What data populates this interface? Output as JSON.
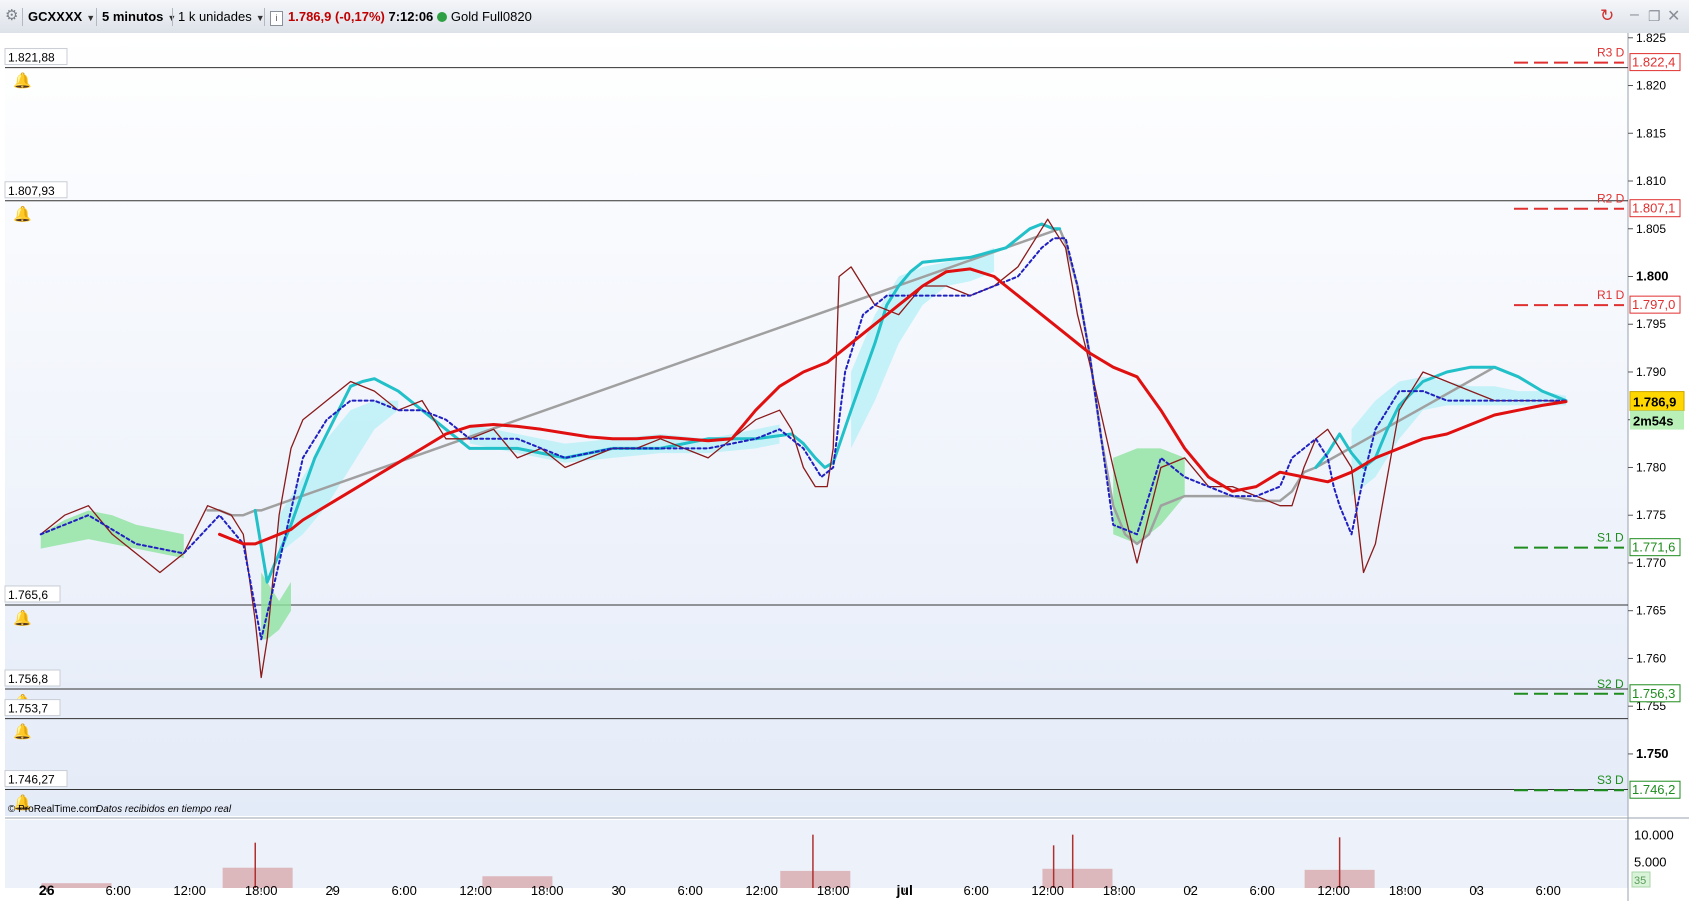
{
  "toolbar": {
    "symbol": "GCXXXX",
    "interval": "5 minutos",
    "units": "1 k unidades",
    "info_icon": "info-icon",
    "price_change": "1.786,9 (-0,17%)",
    "time": "7:12:06",
    "instrument": "Gold Full0820",
    "status_color": "#2ea043",
    "window_icons": [
      "minimize-icon",
      "restore-icon",
      "close-icon"
    ]
  },
  "chart_data": {
    "type": "line",
    "title": "",
    "credit": "© ProRealTime.com",
    "credit_note": "Datos recibidos en tiempo real",
    "price_axis": {
      "ylim": [
        1743.5,
        1825.5
      ],
      "ticks": [
        "1.825",
        "1.820",
        "1.815",
        "1.810",
        "1.805",
        "1.800",
        "1.795",
        "1.790",
        "1.785",
        "1.780",
        "1.775",
        "1.770",
        "1.765",
        "1.760",
        "1.755",
        "1.750"
      ],
      "bold_ticks": [
        "1.800",
        "1.750"
      ],
      "current_price": "1.786,9",
      "countdown": "2m54s"
    },
    "x_axis": {
      "labels": [
        "26",
        "6:00",
        "12:00",
        "18:00",
        "29",
        "6:00",
        "12:00",
        "18:00",
        "30",
        "6:00",
        "12:00",
        "18:00",
        "jul",
        "6:00",
        "12:00",
        "18:00",
        "02",
        "6:00",
        "12:00",
        "18:00",
        "03",
        "6:00"
      ],
      "bold_labels": [
        "26",
        "29",
        "30",
        "jul",
        "02",
        "03"
      ],
      "label_positions": [
        0.5,
        6.5,
        12.5,
        18.5,
        24.5,
        30.5,
        36.5,
        42.5,
        48.5,
        54.5,
        60.5,
        66.5,
        72.5,
        78.5,
        84.5,
        90.5,
        96.5,
        102.5,
        108.5,
        114.5,
        120.5,
        126.5
      ],
      "xlim": [
        -3.0,
        133.2
      ]
    },
    "alert_lines": [
      {
        "label": "1.821,88",
        "value": 1821.88
      },
      {
        "label": "1.807,93",
        "value": 1807.93
      },
      {
        "label": "1.765,6",
        "value": 1765.6
      },
      {
        "label": "1.756,8",
        "value": 1756.8
      },
      {
        "label": "1.753,7",
        "value": 1753.7
      },
      {
        "label": "1.746,27",
        "value": 1746.27
      }
    ],
    "pivot_levels": [
      {
        "name": "R3 D",
        "value_label": "1.822,4",
        "value": 1822.4,
        "color": "#e03030"
      },
      {
        "name": "R2 D",
        "value_label": "1.807,1",
        "value": 1807.1,
        "color": "#e03030"
      },
      {
        "name": "R1 D",
        "value_label": "1.797,0",
        "value": 1797.0,
        "color": "#e03030"
      },
      {
        "name": "S1 D",
        "value_label": "1.771,6",
        "value": 1771.6,
        "color": "#1e8c1e"
      },
      {
        "name": "S2 D",
        "value_label": "1.756,3",
        "value": 1756.3,
        "color": "#1e8c1e"
      },
      {
        "name": "S3 D",
        "value_label": "1.746,2",
        "value": 1746.2,
        "color": "#1e8c1e"
      }
    ],
    "series": [
      {
        "key": "price",
        "color": "#8b1a1a",
        "x": [
          0,
          2,
          4,
          6,
          8,
          10,
          12,
          14,
          16,
          17,
          18,
          18.5,
          19,
          20,
          21,
          22,
          23,
          24,
          26,
          28,
          30,
          32,
          34,
          36,
          38,
          40,
          42,
          44,
          46,
          48,
          50,
          52,
          54,
          56,
          58,
          60,
          62,
          63,
          64,
          65,
          66,
          66.5,
          67,
          68,
          70,
          72,
          74,
          76,
          78,
          80,
          82,
          83,
          84,
          84.5,
          85,
          86,
          87,
          88,
          90,
          92,
          94,
          96,
          98,
          100,
          102,
          104,
          105,
          106,
          107,
          108,
          109,
          110,
          111,
          112,
          114,
          116,
          118,
          120,
          122,
          124,
          126,
          128
        ],
        "values": [
          1773,
          1775,
          1776,
          1773,
          1771,
          1769,
          1771,
          1776,
          1775,
          1773,
          1764,
          1758,
          1762,
          1775,
          1782,
          1785,
          1786,
          1787,
          1789,
          1788,
          1786,
          1787,
          1783,
          1783,
          1784,
          1781,
          1782,
          1780,
          1781,
          1782,
          1782,
          1783,
          1782,
          1781,
          1783,
          1785,
          1786,
          1784,
          1780,
          1778,
          1778,
          1782,
          1800,
          1801,
          1797,
          1796,
          1799,
          1799,
          1798,
          1799,
          1801,
          1803,
          1805,
          1806,
          1805,
          1803,
          1796,
          1791,
          1780,
          1770,
          1780,
          1781,
          1778,
          1778,
          1777,
          1776,
          1776,
          1780,
          1783,
          1784,
          1782,
          1780,
          1769,
          1772,
          1786,
          1790,
          1789,
          1788,
          1787,
          1787,
          1787,
          1786.9
        ]
      },
      {
        "key": "ma_fast",
        "color": "#2020c0",
        "x": [
          0,
          4,
          8,
          12,
          15,
          17,
          18.5,
          20,
          22,
          24,
          26,
          28,
          30,
          32,
          34,
          36,
          38,
          40,
          44,
          48,
          52,
          56,
          60,
          62,
          64,
          65.5,
          66.5,
          67.5,
          69,
          71,
          74,
          78,
          82,
          84,
          85,
          86,
          87,
          88,
          89,
          90,
          92,
          94,
          96,
          98,
          100,
          102,
          104,
          105,
          106,
          107,
          108,
          108.5,
          109,
          110,
          111,
          112,
          114,
          116,
          118,
          120,
          122,
          124,
          126,
          128
        ],
        "values": [
          1773,
          1775,
          1772,
          1771,
          1775,
          1772,
          1762,
          1770,
          1781,
          1785,
          1787,
          1787,
          1786,
          1786,
          1785,
          1783,
          1783,
          1783,
          1781,
          1782,
          1782,
          1782,
          1783,
          1784,
          1782,
          1779,
          1780,
          1790,
          1796,
          1798,
          1798,
          1798,
          1800,
          1803,
          1804,
          1804,
          1799,
          1792,
          1783,
          1774,
          1773,
          1781,
          1779,
          1778,
          1777,
          1777,
          1778,
          1781,
          1782,
          1783,
          1781,
          1778,
          1776,
          1773,
          1779,
          1784,
          1788,
          1788,
          1787,
          1787,
          1787,
          1787,
          1787,
          1787
        ]
      },
      {
        "key": "ma_mid_cyan",
        "color": "#22c0c8",
        "x": [
          18,
          19,
          21,
          23,
          25,
          26,
          27,
          28,
          30,
          32,
          34,
          36,
          38,
          40,
          44,
          48,
          52,
          56,
          60,
          63,
          64,
          65,
          65.8,
          66.5,
          68,
          70,
          71,
          72,
          73,
          74,
          78,
          81,
          82,
          83,
          84,
          85,
          85.5
        ],
        "values": [
          1775.5,
          1768,
          1774,
          1781,
          1786,
          1788.5,
          1789,
          1789.3,
          1788,
          1786,
          1784,
          1782,
          1782,
          1782,
          1781,
          1782,
          1782,
          1783,
          1783,
          1783.5,
          1782.5,
          1781,
          1780,
          1780.5,
          1786,
          1793,
          1797,
          1799,
          1800.5,
          1801.5,
          1802,
          1803,
          1804,
          1805,
          1805.5,
          1805,
          1805
        ],
        "x2": [
          107,
          108,
          109,
          110,
          111,
          112,
          113,
          114,
          116,
          118,
          120,
          122,
          124,
          126,
          128
        ],
        "values2": [
          1780,
          1781.5,
          1783.5,
          1781.5,
          1780,
          1781,
          1784,
          1786.5,
          1789,
          1790,
          1790.5,
          1790.5,
          1789.5,
          1788,
          1787
        ]
      },
      {
        "key": "ma_mid_gray",
        "color": "#a0a0a0",
        "x": [
          14,
          15,
          16,
          17,
          18,
          18.5,
          85.5,
          86,
          87,
          88,
          89,
          90,
          91,
          92,
          93,
          94,
          96,
          98,
          100,
          102,
          104,
          105,
          106,
          107,
          122,
          124,
          126,
          128
        ],
        "values": [
          1775.5,
          1775.5,
          1775,
          1775,
          1775.5,
          1775.5,
          1805,
          1803.5,
          1799,
          1792,
          1783,
          1776,
          1773,
          1772,
          1773,
          1776,
          1777,
          1777,
          1777,
          1776.5,
          1776.5,
          1777.5,
          1779.5,
          1780,
          1790.5,
          1789.5,
          1788,
          1787
        ]
      },
      {
        "key": "ma_slow",
        "color": "#e01010",
        "x": [
          15,
          16,
          17,
          18,
          19,
          20,
          21,
          22,
          24,
          26,
          28,
          30,
          32,
          34,
          36,
          38,
          40,
          42,
          44,
          46,
          48,
          50,
          52,
          54,
          56,
          58,
          60,
          62,
          64,
          66,
          68,
          70,
          72,
          74,
          76,
          78,
          80,
          82,
          84,
          86,
          88,
          90,
          92,
          94,
          96,
          98,
          100,
          102,
          104,
          106,
          108,
          110,
          112,
          114,
          116,
          118,
          120,
          122,
          124,
          126,
          128
        ],
        "values": [
          1773,
          1772.5,
          1772,
          1772,
          1772.5,
          1773,
          1773.5,
          1774.5,
          1776,
          1777.5,
          1779,
          1780.5,
          1782,
          1783.5,
          1784.3,
          1784.5,
          1784.3,
          1784,
          1783.6,
          1783.2,
          1783,
          1783,
          1783.2,
          1783,
          1782.8,
          1783,
          1786,
          1788.5,
          1790,
          1791,
          1793,
          1795,
          1797,
          1799,
          1800.5,
          1800.8,
          1800,
          1798,
          1796,
          1794,
          1792,
          1790.5,
          1789.5,
          1786,
          1782,
          1779,
          1777.5,
          1778,
          1779.5,
          1779,
          1778.5,
          1779.5,
          1781,
          1782,
          1783,
          1783.5,
          1784.5,
          1785.5,
          1786,
          1786.5,
          1786.9
        ]
      }
    ],
    "cloud_series": [
      {
        "color": "#8ee2a0",
        "segments": [
          {
            "x": [
              0,
              2,
              4,
              6,
              8,
              10,
              12
            ],
            "top": [
              1773,
              1774.5,
              1775.5,
              1775,
              1774,
              1773.5,
              1773
            ],
            "bottom": [
              1771.5,
              1772,
              1772.5,
              1772,
              1771.5,
              1771,
              1770.5
            ]
          },
          {
            "x": [
              18.5,
              19,
              20,
              21
            ],
            "top": [
              1769,
              1768,
              1766,
              1768
            ],
            "bottom": [
              1762,
              1762,
              1763,
              1765
            ]
          },
          {
            "x": [
              90,
              92,
              94,
              96
            ],
            "top": [
              1781,
              1782,
              1782,
              1781
            ],
            "bottom": [
              1773,
              1772,
              1774,
              1777
            ]
          }
        ]
      },
      {
        "color": "#b9f0f8",
        "segments": [
          {
            "x": [
              20,
              22,
              24,
              26,
              28,
              30
            ],
            "top": [
              1775,
              1779,
              1783,
              1786,
              1787,
              1787
            ],
            "bottom": [
              1771,
              1773,
              1776,
              1780,
              1784,
              1786
            ]
          },
          {
            "x": [
              36,
              40,
              44,
              48,
              52,
              56,
              60,
              62
            ],
            "top": [
              1784.5,
              1783.5,
              1782.5,
              1783,
              1783.5,
              1783,
              1784,
              1784.5
            ],
            "bottom": [
              1782.5,
              1781.5,
              1780.5,
              1781,
              1781.5,
              1781.5,
              1782,
              1782.5
            ]
          },
          {
            "x": [
              68,
              70,
              72,
              74,
              76,
              78,
              80
            ],
            "top": [
              1790,
              1796,
              1800,
              1801,
              1801.5,
              1802,
              1803
            ],
            "bottom": [
              1782,
              1787,
              1793,
              1797,
              1799,
              1799.5,
              1800.5
            ]
          },
          {
            "x": [
              110,
              112,
              114,
              116,
              118,
              120,
              122,
              124,
              126,
              128
            ],
            "top": [
              1784,
              1787,
              1789,
              1789.5,
              1789,
              1788.5,
              1788.5,
              1788,
              1788,
              1787.5
            ],
            "bottom": [
              1777,
              1779,
              1783,
              1786,
              1786.5,
              1786.5,
              1786.5,
              1786.5,
              1786.5,
              1786.5
            ]
          }
        ]
      }
    ],
    "volume_axis": {
      "ylim": [
        0,
        12000
      ],
      "ticks": [
        "10.000",
        "5.000"
      ],
      "last_volume": "35"
    },
    "volume_spikes": [
      {
        "x": 18.0,
        "value": 8500
      },
      {
        "x": 64.8,
        "value": 10000
      },
      {
        "x": 85.0,
        "value": 8000
      },
      {
        "x": 86.6,
        "value": 10000
      },
      {
        "x": 109.0,
        "value": 9500
      }
    ],
    "volume_clusters": [
      {
        "x": 3.0,
        "value": 900
      },
      {
        "x": 18.2,
        "value": 3800
      },
      {
        "x": 40.0,
        "value": 2200
      },
      {
        "x": 65.0,
        "value": 3200
      },
      {
        "x": 87.0,
        "value": 3600
      },
      {
        "x": 109.0,
        "value": 3400
      }
    ]
  }
}
